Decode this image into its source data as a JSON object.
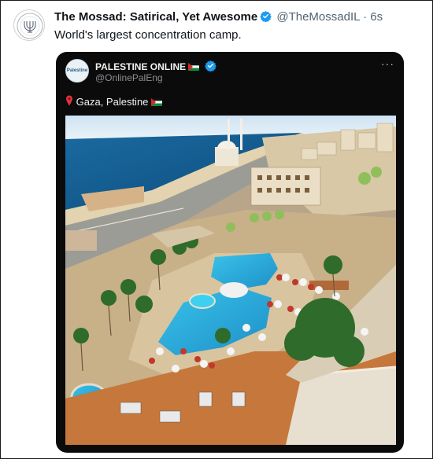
{
  "tweet": {
    "author_name": "The Mossad: Satirical, Yet Awesome",
    "handle": "@TheMossadIL",
    "separator": "·",
    "time": "6s",
    "text": "World's largest concentration camp."
  },
  "quoted": {
    "author_name": "PALESTINE ONLINE",
    "handle": "@OnlinePalEng",
    "avatar_text": "Palestine",
    "more_label": "···",
    "text": "Gaza, Palestine"
  },
  "colors": {
    "verified": "#1d9bf0",
    "accent_name": "#0f1419",
    "muted": "#536471"
  }
}
